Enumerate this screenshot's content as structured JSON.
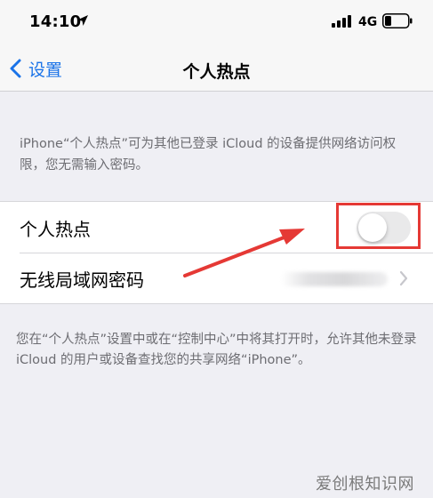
{
  "status_bar": {
    "time": "14:10",
    "network": "4G"
  },
  "nav_bar": {
    "back_label": "设置",
    "title": "个人热点"
  },
  "description_top": "iPhone“个人热点”可为其他已登录 iCloud 的设备提供网络访问权限，您无需输入密码。",
  "settings": {
    "hotspot": {
      "label": "个人热点",
      "enabled": false
    },
    "wifi_password": {
      "label": "无线局域网密码"
    }
  },
  "description_bottom": "您在“个人热点”设置中或在“控制中心”中将其打开时，允许其他未登录 iCloud 的用户或设备查找您的共享网络“iPhone”。",
  "watermark": "爱创根知识网",
  "colors": {
    "accent": "#1a73e8",
    "highlight": "#e53935",
    "background": "#efeff4"
  }
}
